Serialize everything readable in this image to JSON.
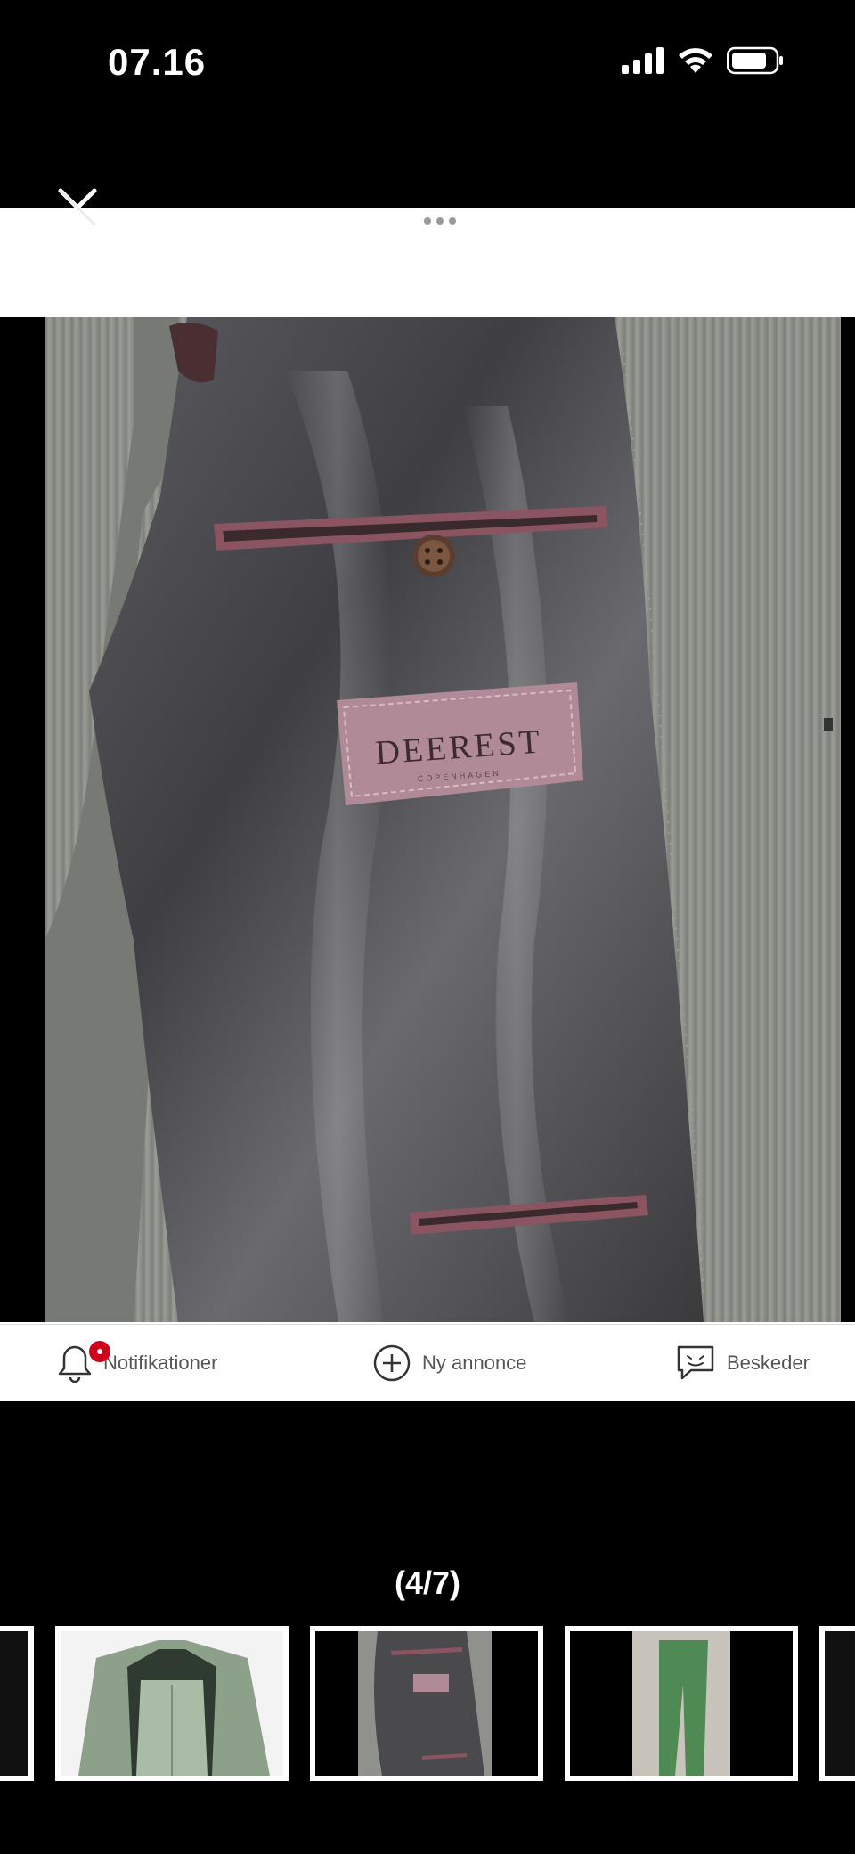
{
  "status_bar": {
    "time": "07.16",
    "icons": [
      "cellular-signal-icon",
      "wifi-icon",
      "battery-icon"
    ]
  },
  "viewer": {
    "close_icon": "close-icon",
    "more_icon": "more-dots-icon",
    "photo_label_text": "DEEREST",
    "photo_label_subtext": "COPENHAGEN",
    "counter": "(4/7)"
  },
  "bottom_nav": {
    "items": [
      {
        "label": "Notifikationer",
        "icon": "bell-icon",
        "has_badge": true
      },
      {
        "label": "Ny annonce",
        "icon": "plus-circle-icon"
      },
      {
        "label": "Beskeder",
        "icon": "chat-icon"
      }
    ]
  },
  "thumbnails": [
    {
      "icon": "thumbnail",
      "subject": "partial-previous"
    },
    {
      "icon": "thumbnail",
      "subject": "green-suit-jacket-and-trousers"
    },
    {
      "icon": "thumbnail",
      "subject": "jacket-lining-label"
    },
    {
      "icon": "thumbnail",
      "subject": "green-trousers"
    },
    {
      "icon": "thumbnail",
      "subject": "partial-next"
    }
  ],
  "colors": {
    "badge": "#d0021b",
    "lining": "#4a4a4d",
    "pocket_piping": "#8a5560",
    "suit_grey": "#8f928c"
  }
}
